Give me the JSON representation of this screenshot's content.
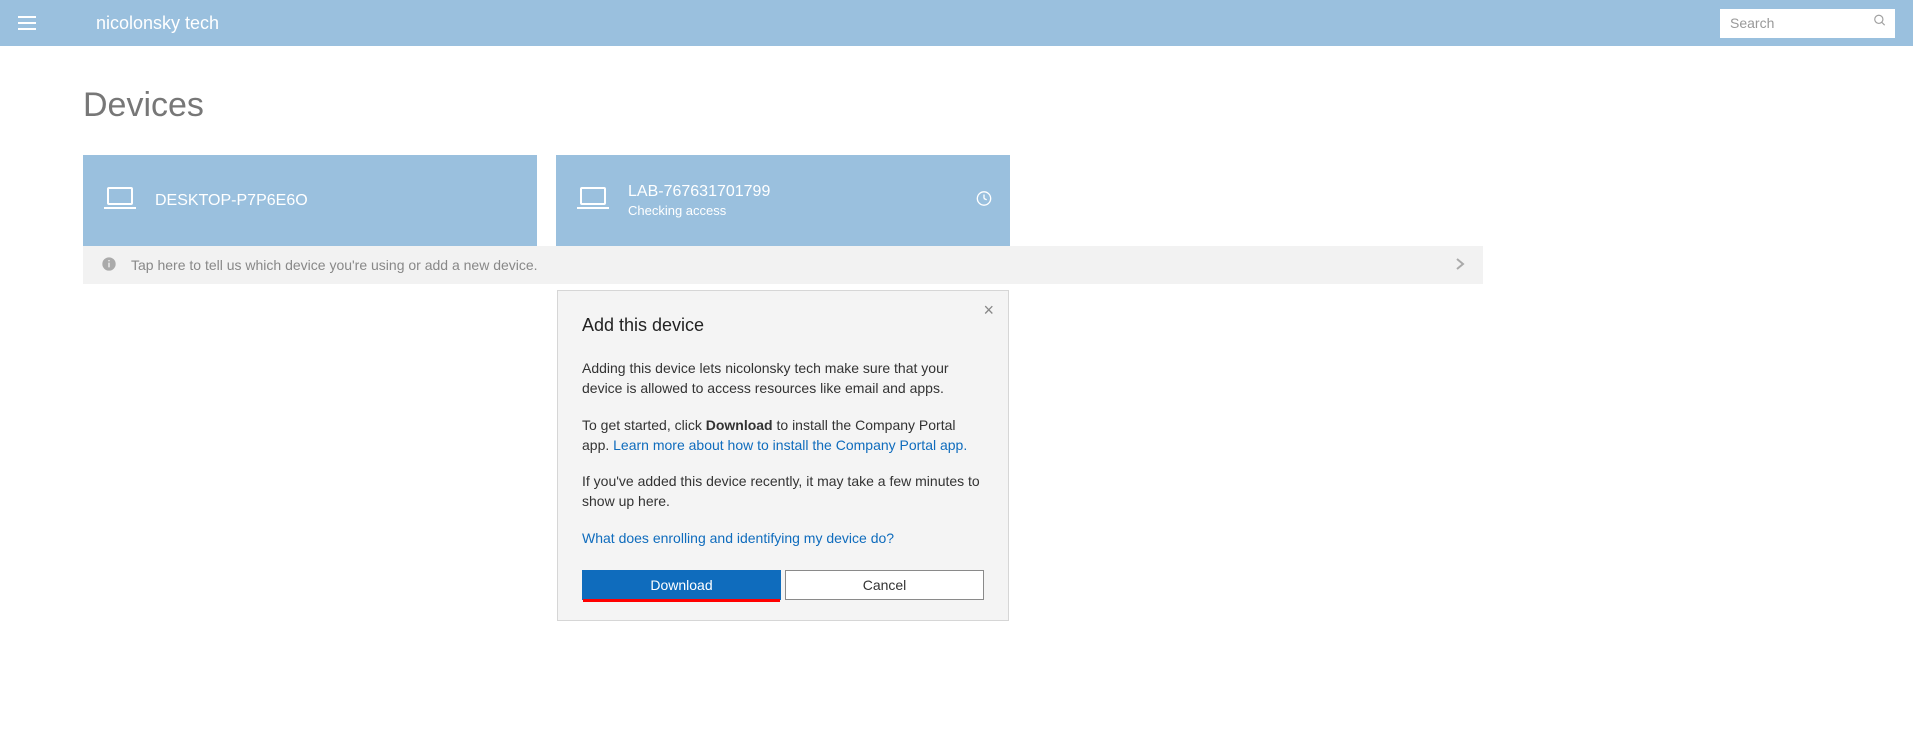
{
  "header": {
    "brand": "nicolonsky tech",
    "search_placeholder": "Search"
  },
  "page": {
    "title": "Devices"
  },
  "devices": [
    {
      "name": "DESKTOP-P7P6E6O",
      "status": null,
      "has_clock": false
    },
    {
      "name": "LAB-767631701799",
      "status": "Checking access",
      "has_clock": true
    }
  ],
  "info_banner": {
    "text": "Tap here to tell us which device you're using or add a new device."
  },
  "popover": {
    "title": "Add this device",
    "paragraph1": "Adding this device lets nicolonsky tech make sure that your device is allowed to access resources like email and apps.",
    "paragraph2_pre": "To get started, click ",
    "paragraph2_bold": "Download",
    "paragraph2_post": " to install the Company Portal app. ",
    "learn_more_link": "Learn more about how to install the Company Portal app.",
    "paragraph3": "If you've added this device recently, it may take a few minutes to show up here.",
    "enroll_link": "What does enrolling and identifying my device do?",
    "download_label": "Download",
    "cancel_label": "Cancel"
  }
}
